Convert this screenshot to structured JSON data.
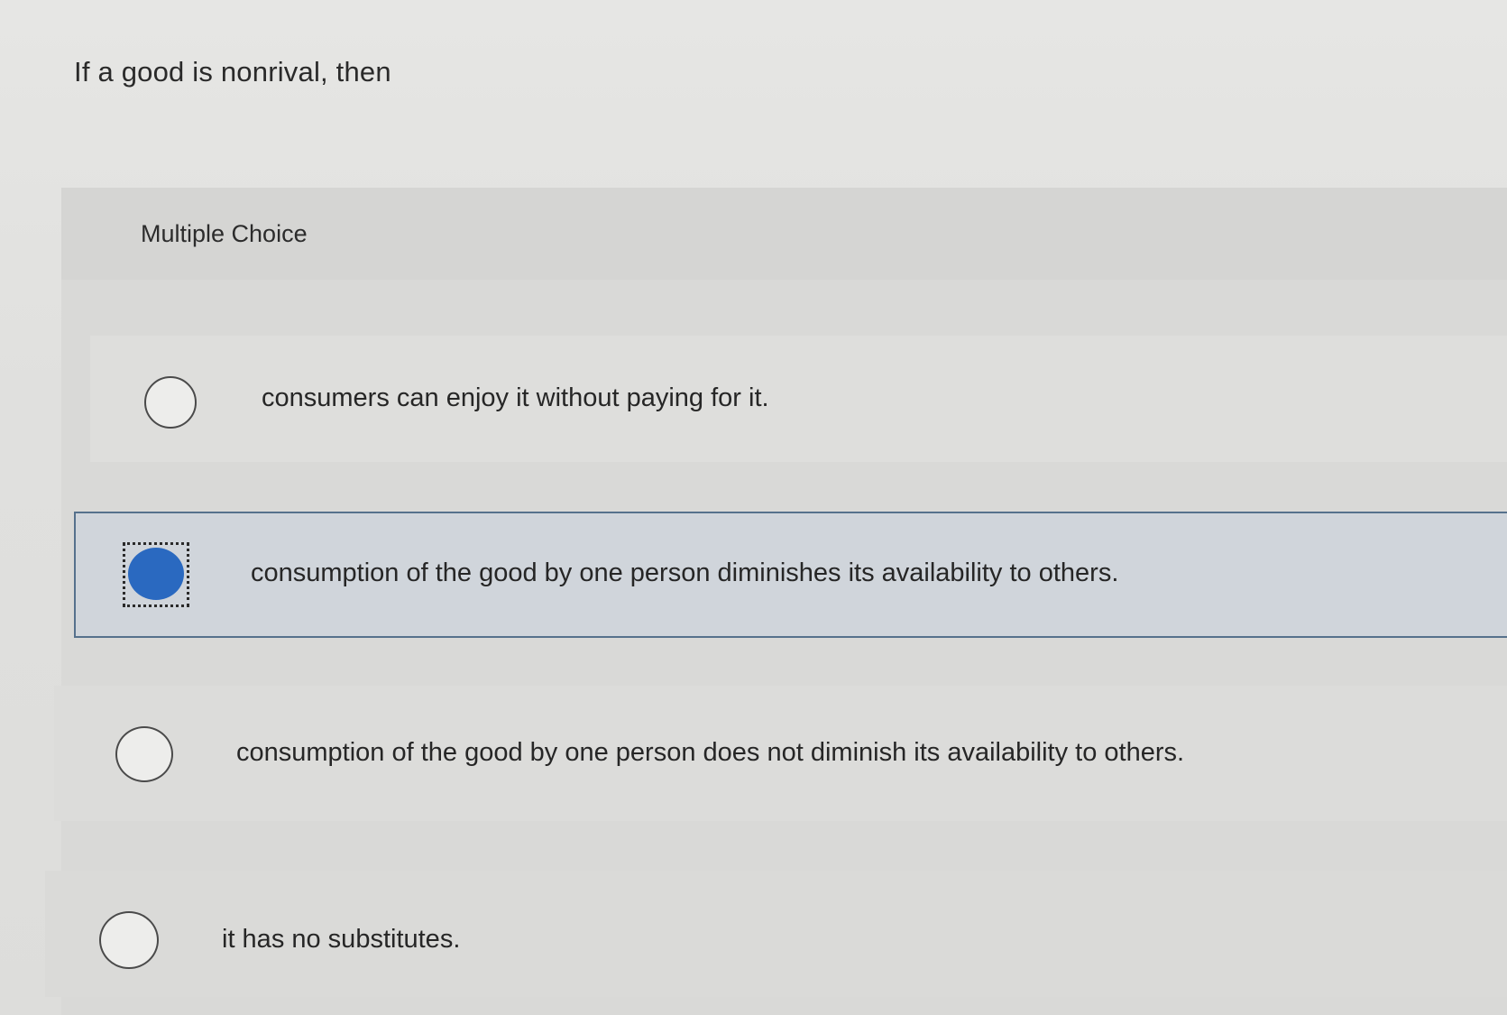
{
  "question": {
    "stem": "If a good is nonrival, then"
  },
  "multiple_choice": {
    "label": "Multiple Choice",
    "selected_index": 1,
    "colors": {
      "selected_radio": "#2a69c0",
      "selected_border": "#56718c",
      "selected_background": "#d0d5db"
    },
    "options": [
      {
        "text": "consumers can enjoy it without paying for it.",
        "selected": false
      },
      {
        "text": "consumption of the good by one person diminishes its availability to others.",
        "selected": true
      },
      {
        "text": "consumption of the good by one person does not diminish its availability to others.",
        "selected": false
      },
      {
        "text": "it has no substitutes.",
        "selected": false
      }
    ]
  }
}
